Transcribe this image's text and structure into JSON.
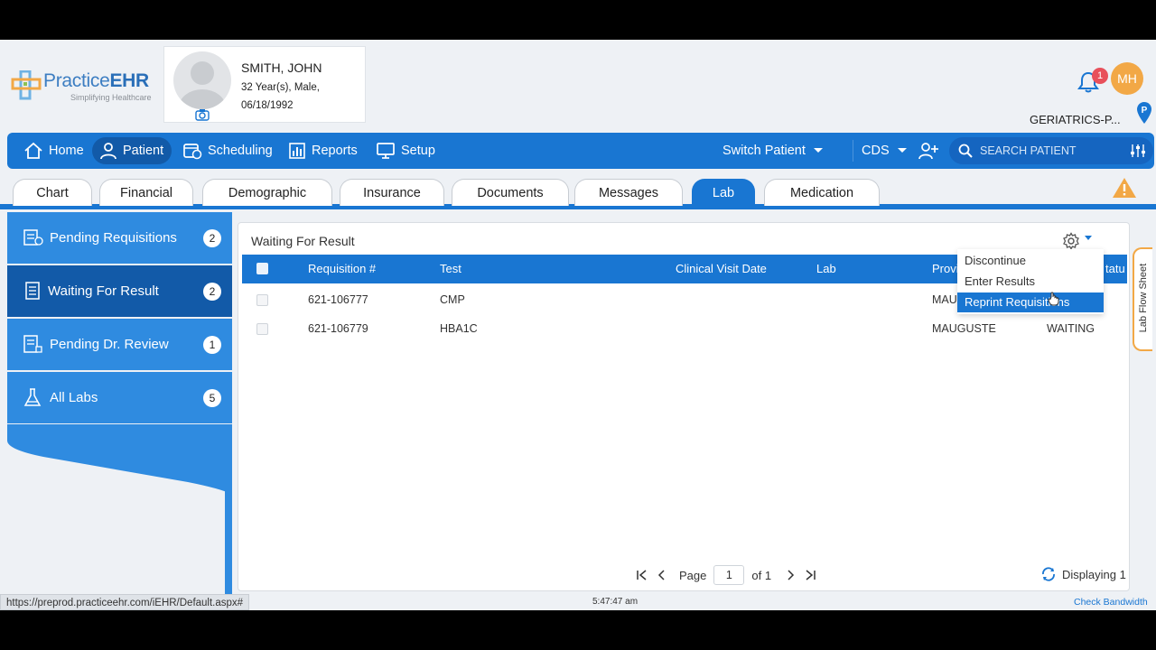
{
  "logo": {
    "brand_light": "Practice",
    "brand_bold": "EHR",
    "tagline": "Simplifying Healthcare"
  },
  "patient": {
    "name": "SMITH, JOHN",
    "line1": "32 Year(s), Male,",
    "line2": "06/18/1992"
  },
  "header": {
    "notification_count": "1",
    "user_initials": "MH",
    "practice": "GERIATRICS-P..."
  },
  "nav": {
    "home": "Home",
    "patient": "Patient",
    "scheduling": "Scheduling",
    "reports": "Reports",
    "setup": "Setup",
    "switch_patient": "Switch Patient",
    "cds": "CDS",
    "search_placeholder": "SEARCH PATIENT"
  },
  "tabs": [
    "Chart",
    "Financial",
    "Demographic",
    "Insurance",
    "Documents",
    "Messages",
    "Lab",
    "Medication"
  ],
  "sidebar": [
    {
      "label": "Pending Requisitions",
      "count": "2"
    },
    {
      "label": "Waiting For Result",
      "count": "2"
    },
    {
      "label": "Pending Dr. Review",
      "count": "1"
    },
    {
      "label": "All Labs",
      "count": "5"
    }
  ],
  "panel": {
    "title": "Waiting For Result",
    "columns": {
      "requisition": "Requisition #",
      "test": "Test",
      "visit_date": "Clinical Visit Date",
      "lab": "Lab",
      "provider": "Provi",
      "status": "tatu"
    },
    "rows": [
      {
        "requisition": "621-106777",
        "test": "CMP",
        "visit_date": "",
        "lab": "",
        "provider": "MAU",
        "status": ""
      },
      {
        "requisition": "621-106779",
        "test": "HBA1C",
        "visit_date": "",
        "lab": "",
        "provider": "MAUGUSTE",
        "status": "WAITING"
      }
    ],
    "menu": [
      "Discontinue",
      "Enter Results",
      "Reprint Requisitions"
    ],
    "menu_active_index": 2,
    "pager": {
      "page_label": "Page",
      "page_value": "1",
      "of_label": "of 1",
      "displaying": "Displaying 1"
    }
  },
  "flowsheet_label": "Lab Flow Sheet",
  "status": {
    "url": "https://preprod.practiceehr.com/iEHR/Default.aspx#",
    "time": "5:47:47 am",
    "bandwidth": "Check Bandwidth"
  },
  "colors": {
    "primary": "#1976d2",
    "primary_dark": "#125aa8",
    "sidebar": "#2f8be0",
    "accent": "#f2a846",
    "badge": "#e8505b"
  }
}
